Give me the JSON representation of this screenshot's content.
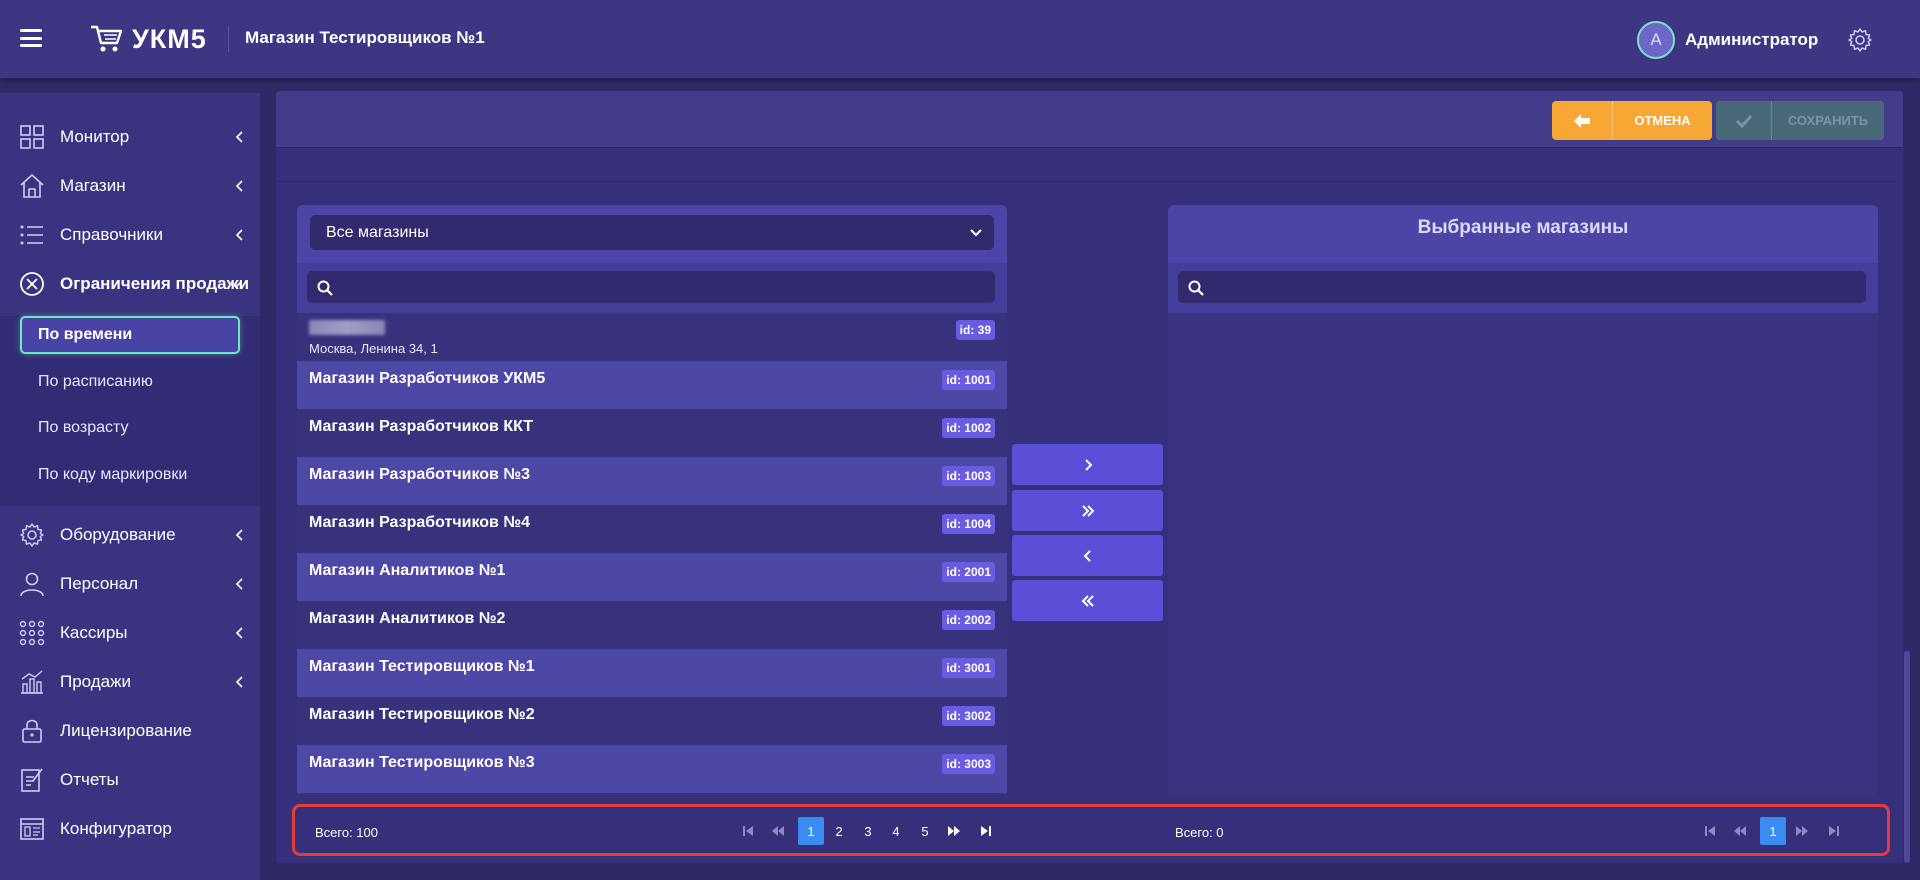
{
  "header": {
    "logo_text": "УКМ5",
    "store_title": "Магазин Тестировщиков №1",
    "user_initial": "А",
    "user_name": "Администратор"
  },
  "sidebar": {
    "items": [
      {
        "label": "Монитор",
        "icon": "monitor-icon"
      },
      {
        "label": "Магазин",
        "icon": "store-icon"
      },
      {
        "label": "Справочники",
        "icon": "list-icon"
      },
      {
        "label": "Ограничения продажи",
        "icon": "restriction-icon"
      },
      {
        "label": "Оборудование",
        "icon": "gear-icon"
      },
      {
        "label": "Персонал",
        "icon": "person-icon"
      },
      {
        "label": "Кассиры",
        "icon": "cashiers-icon"
      },
      {
        "label": "Продажи",
        "icon": "sales-chart-icon"
      },
      {
        "label": "Лицензирование",
        "icon": "lock-icon"
      },
      {
        "label": "Отчеты",
        "icon": "report-icon"
      },
      {
        "label": "Конфигуратор",
        "icon": "configurator-icon"
      }
    ],
    "submenu": [
      {
        "label": "По времени"
      },
      {
        "label": "По расписанию"
      },
      {
        "label": "По возрасту"
      },
      {
        "label": "По коду маркировки"
      }
    ]
  },
  "toolbar": {
    "cancel_label": "ОТМЕНА",
    "save_label": "СОХРАНИТЬ"
  },
  "left_panel": {
    "select_value": "Все магазины",
    "search_placeholder": "",
    "first_row": {
      "address": "Москва, Ленина 34, 1",
      "badge": "id: 39"
    },
    "rows": [
      {
        "name": "Магазин Разработчиков УКМ5",
        "badge": "id: 1001"
      },
      {
        "name": "Магазин Разработчиков ККТ",
        "badge": "id: 1002"
      },
      {
        "name": "Магазин Разработчиков №3",
        "badge": "id: 1003"
      },
      {
        "name": "Магазин Разработчиков №4",
        "badge": "id: 1004"
      },
      {
        "name": "Магазин Аналитиков №1",
        "badge": "id: 2001"
      },
      {
        "name": "Магазин Аналитиков №2",
        "badge": "id: 2002"
      },
      {
        "name": "Магазин Тестировщиков №1",
        "badge": "id: 3001"
      },
      {
        "name": "Магазин Тестировщиков №2",
        "badge": "id: 3002"
      },
      {
        "name": "Магазин Тестировщиков №3",
        "badge": "id: 3003"
      }
    ],
    "total": "Всего: 100",
    "pages": [
      "1",
      "2",
      "3",
      "4",
      "5"
    ]
  },
  "right_panel": {
    "title": "Выбранные магазины",
    "search_placeholder": "",
    "total": "Всего: 0",
    "pages": [
      "1"
    ]
  },
  "colors": {
    "background": "#2f2968",
    "accent_orange": "#f7a733",
    "badge_purple": "#6a5ce0",
    "active_green": "#6ee7c0",
    "page_blue": "#3a8cf0",
    "highlight_red": "#e23c3c"
  }
}
